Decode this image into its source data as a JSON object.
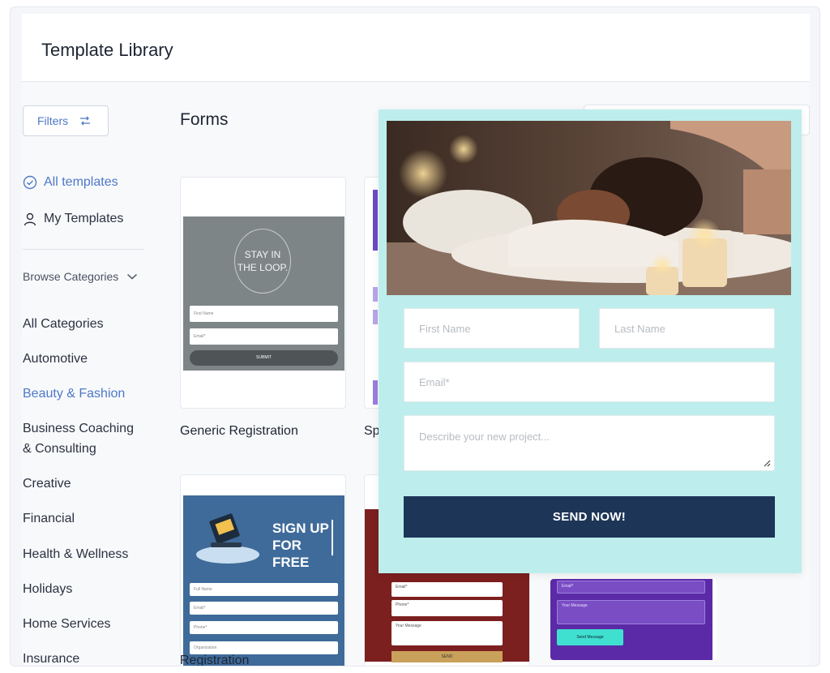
{
  "header": {
    "title": "Template Library"
  },
  "sidebar": {
    "filters_label": "Filters",
    "nav": [
      {
        "label": "All templates",
        "active": true,
        "icon": "check-circle-icon"
      },
      {
        "label": "My Templates",
        "active": false,
        "icon": "user-icon"
      }
    ],
    "browse_label": "Browse Categories",
    "categories": [
      "All Categories",
      "Automotive",
      "Beauty & Fashion",
      "Business Coaching & Consulting",
      "Creative",
      "Financial",
      "Health & Wellness",
      "Holidays",
      "Home Services",
      "Insurance"
    ],
    "active_category": "Beauty & Fashion"
  },
  "main": {
    "title": "Forms",
    "cards": [
      {
        "title": "Generic Registration",
        "preview": {
          "headline": "STAY IN THE LOOP.",
          "fields": [
            "First Name",
            "Email*"
          ],
          "button": "SUBMIT"
        }
      },
      {
        "title": "Sp"
      },
      {
        "title": "Registration",
        "preview": {
          "headline": "SIGN UP FOR FREE",
          "fields": [
            "Full Name",
            "Email*",
            "Phone*",
            "Organization"
          ]
        }
      },
      {
        "title": "",
        "preview": {
          "fields": [
            "Email*",
            "Phone*",
            "Your Message"
          ],
          "button": "SEND"
        }
      },
      {
        "title": "",
        "preview": {
          "fields": [
            "Email*",
            "Your Message"
          ],
          "button": "Send Message"
        }
      }
    ]
  },
  "overlay_form": {
    "first_name_placeholder": "First Name",
    "last_name_placeholder": "Last Name",
    "email_placeholder": "Email*",
    "project_placeholder": "Describe your new project...",
    "submit_label": "SEND NOW!"
  },
  "colors": {
    "accent": "#4d78c8",
    "overlay_bg": "#bdeeed",
    "submit_bg": "#1d3557"
  }
}
